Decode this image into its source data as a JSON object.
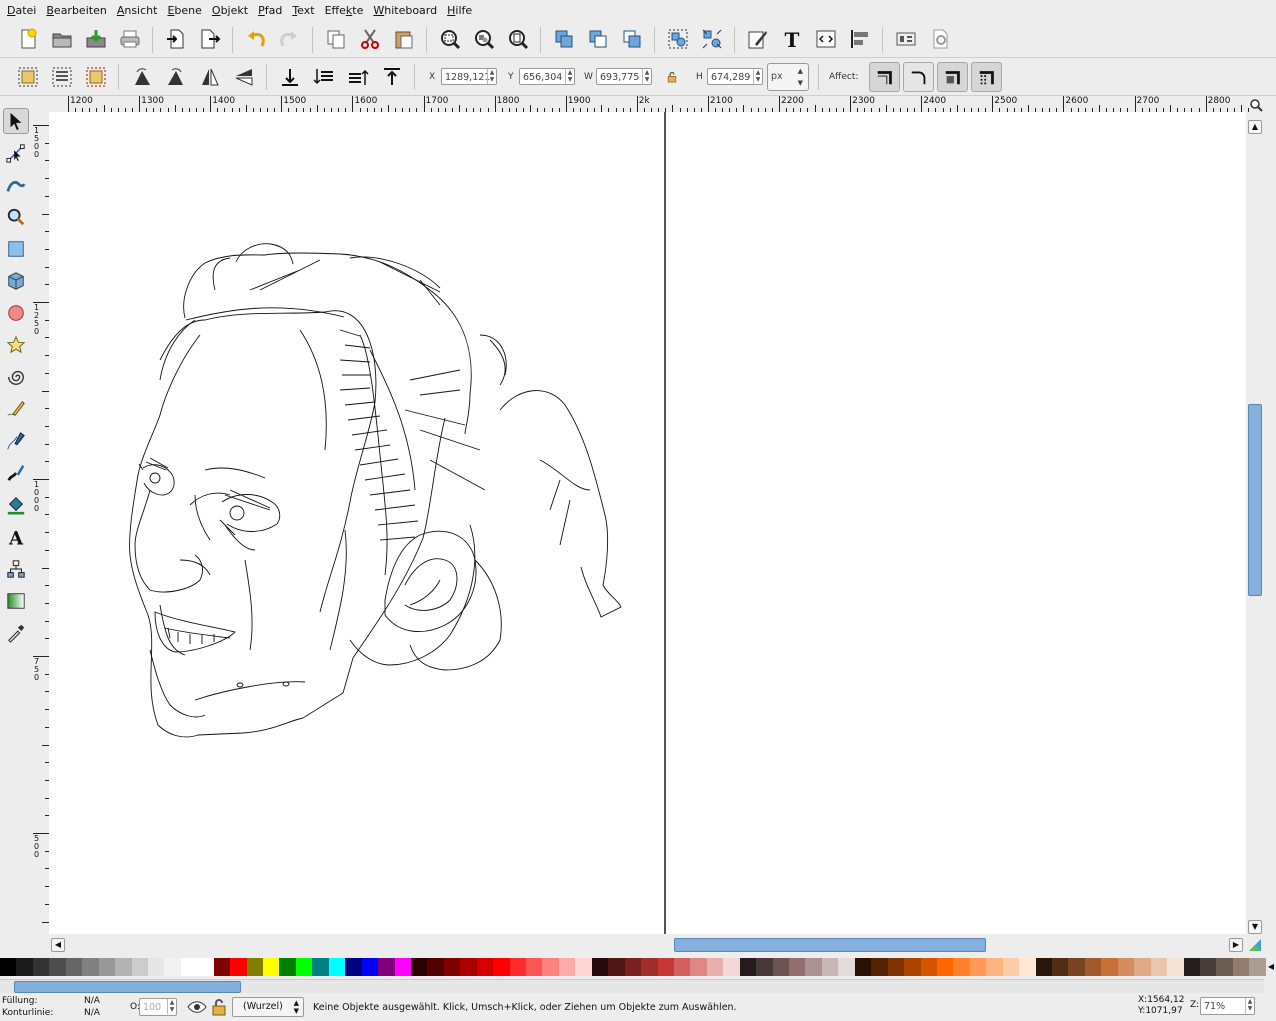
{
  "menu": [
    {
      "label": "Datei",
      "accel": "D"
    },
    {
      "label": "Bearbeiten",
      "accel": "B"
    },
    {
      "label": "Ansicht",
      "accel": "A"
    },
    {
      "label": "Ebene",
      "accel": "E"
    },
    {
      "label": "Objekt",
      "accel": "O"
    },
    {
      "label": "Pfad",
      "accel": "P"
    },
    {
      "label": "Text",
      "accel": "T"
    },
    {
      "label": "Effekte",
      "accel": "k"
    },
    {
      "label": "Whiteboard",
      "accel": "W"
    },
    {
      "label": "Hilfe",
      "accel": "H"
    }
  ],
  "controls": {
    "x_label": "X",
    "x_value": "1289,121",
    "y_label": "Y",
    "y_value": "656,304",
    "w_label": "W",
    "w_value": "693,775",
    "h_label": "H",
    "h_value": "674,289",
    "unit": "px",
    "affect_label": "Affect:"
  },
  "ruler": {
    "h_ticks": [
      "1200",
      "1300",
      "1400",
      "1500",
      "1600",
      "1700",
      "1800",
      "1900",
      "2k",
      "2100",
      "2200",
      "2300",
      "2400",
      "2500",
      "2600",
      "2700",
      "2800"
    ],
    "v_ticks": [
      "1500",
      "1250",
      "1000",
      "750",
      "500"
    ]
  },
  "palette": [
    "#000000",
    "#1a1a1a",
    "#333333",
    "#4d4d4d",
    "#666666",
    "#808080",
    "#999999",
    "#b3b3b3",
    "#cccccc",
    "#e6e6e6",
    "#f2f2f2",
    "#ffffff",
    "#ffffff",
    "#800000",
    "#ff0000",
    "#808000",
    "#ffff00",
    "#008000",
    "#00ff00",
    "#008080",
    "#00ffff",
    "#000080",
    "#0000ff",
    "#800080",
    "#ff00ff",
    "#2b0000",
    "#550000",
    "#800000",
    "#aa0000",
    "#d40000",
    "#ff0000",
    "#ff2a2a",
    "#ff5555",
    "#ff8080",
    "#ffaaaa",
    "#ffd5d5",
    "#280b0b",
    "#501616",
    "#782121",
    "#a02c2c",
    "#c83737",
    "#d35f5f",
    "#de8787",
    "#e9afaf",
    "#f4d7d7",
    "#241c1c",
    "#483737",
    "#6c5353",
    "#916f6f",
    "#ac9393",
    "#c8b7b7",
    "#e3dbdb",
    "#2b1100",
    "#552200",
    "#803300",
    "#aa4400",
    "#d45500",
    "#ff6600",
    "#ff7f2a",
    "#ff9955",
    "#ffb380",
    "#ffccaa",
    "#ffe6d5",
    "#28170b",
    "#502d16",
    "#784421",
    "#a05a2c",
    "#c87137",
    "#d38d5f",
    "#deaa87",
    "#e9c6af",
    "#f4e3d7",
    "#241f1c",
    "#483e37",
    "#6c5d53",
    "#917c6f",
    "#ac9d93"
  ],
  "status": {
    "fill_label": "Füllung:",
    "fill_value": "N/A",
    "stroke_label": "Konturlinie:",
    "stroke_value": "N/A",
    "opacity_label": "O:",
    "opacity_value": "100",
    "layer": "(Wurzel)",
    "message": "Keine Objekte ausgewählt. Klick, Umsch+Klick, oder Ziehen um Objekte zum Auswählen.",
    "cursor_x": "X:1564,12",
    "cursor_y": "Y:1071,97",
    "zoom_label": "Z:",
    "zoom": "71%"
  }
}
